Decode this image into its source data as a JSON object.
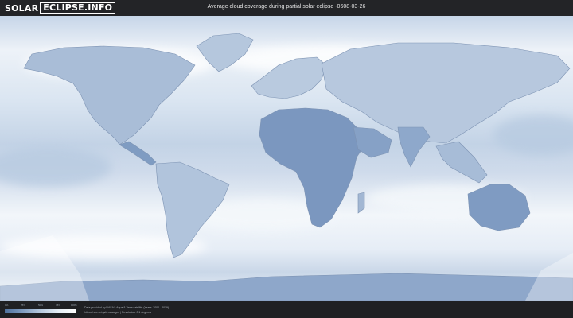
{
  "header": {
    "logo_solar": "SOLAR",
    "logo_site": "ECLIPSE.INFO",
    "title": "Average cloud coverage during partial solar eclipse -0608-03-26"
  },
  "legend": {
    "ticks": [
      "0%",
      "25%",
      "50%",
      "75%",
      "100%"
    ],
    "colors": [
      "#50719d",
      "#7f9cc0",
      "#b6c9de",
      "#e5eef6",
      "#ffffff"
    ]
  },
  "footer": {
    "credit_line1": "Data provided by NASA's Aqua & Terra satellite (Years: 2000 - 2019)",
    "credit_line2": "https://neo.sci.gsfc.nasa.gov | Resolution: 0.1 degrees"
  },
  "colors": {
    "ocean_clear": "#e9f0f8",
    "land_low_cloud": "#6d89b2",
    "coast_outline": "#7d93b3",
    "eclipse_overlay": "#ffffff"
  }
}
